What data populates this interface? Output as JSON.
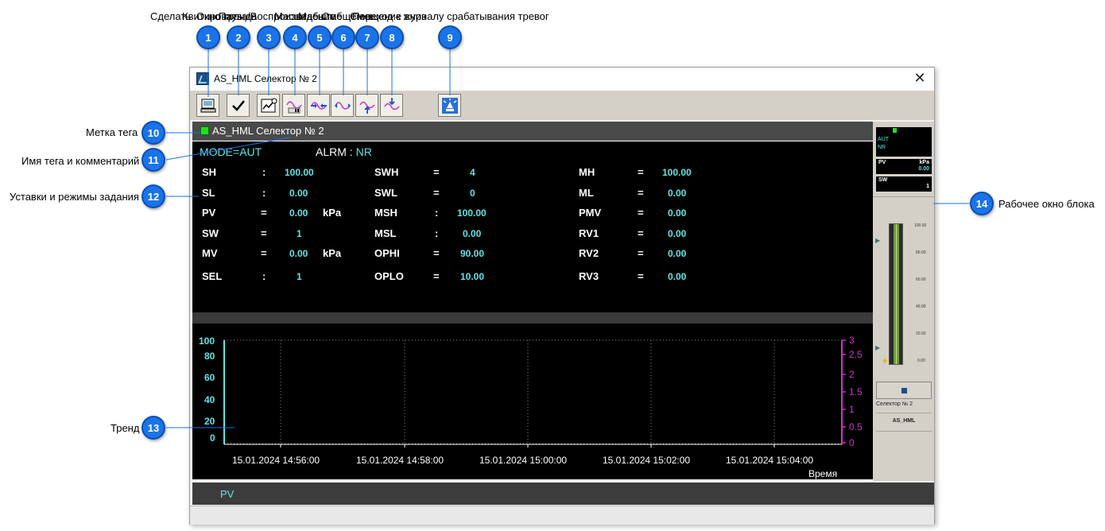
{
  "window": {
    "title": "AS_HML Селектор № 2",
    "close_glyph": "✕"
  },
  "toolbar": {
    "buttons": [
      {
        "icon": "report-icon"
      },
      {
        "icon": "checkmark-icon"
      },
      {
        "icon": "trend-window-icon"
      },
      {
        "icon": "trend-pause-icon"
      },
      {
        "icon": "scale-compress-icon"
      },
      {
        "icon": "scale-expand-icon"
      },
      {
        "icon": "scale-shift-up-icon"
      },
      {
        "icon": "scale-shift-down-icon"
      },
      {
        "icon": "alarm-light-icon"
      }
    ]
  },
  "callouts": {
    "top_label_1": "Сделать",
    "top_label_2": "Квитировать",
    "top_label_3": "Окно тренда",
    "top_label_4": "Пауза/Воспроизведение",
    "top_label_5": "Масштаб",
    "top_label_6": "Масштаб",
    "top_label_7": "Смещение",
    "top_label_8": "Смещение вниз",
    "top_label_9": "Переход к журналу срабатывания тревог",
    "n1": "1",
    "n2": "2",
    "n3": "3",
    "n4": "4",
    "n5": "5",
    "n6": "6",
    "n7": "7",
    "n8": "8",
    "n9": "9",
    "n10": "10",
    "n11": "11",
    "n12": "12",
    "n13": "13",
    "n14": "14",
    "label_10": "Метка тега",
    "label_11": "Имя тега и комментарий",
    "label_12": "Уставки и режимы задания",
    "label_13": "Тренд",
    "label_14": "Рабочее окно блока"
  },
  "tag": {
    "name": "AS_HML Селектор № 2",
    "led_color": "#22dd22"
  },
  "status": {
    "mode_label": "MODE=",
    "mode_value": "AUT",
    "alrm_label": "ALRM : ",
    "alrm_value": "NR"
  },
  "params": {
    "col1": [
      {
        "name": "SH",
        "sep": ":",
        "value": "100.00",
        "unit": ""
      },
      {
        "name": "SL",
        "sep": ":",
        "value": "0.00",
        "unit": ""
      },
      {
        "name": "PV",
        "sep": "=",
        "value": "0.00",
        "unit": "kPa"
      },
      {
        "name": "SW",
        "sep": "=",
        "value": "1",
        "unit": ""
      },
      {
        "name": "MV",
        "sep": "=",
        "value": "0.00",
        "unit": "kPa"
      },
      {
        "name": "SEL",
        "sep": ":",
        "value": "1",
        "unit": ""
      }
    ],
    "col2": [
      {
        "name": "SWH",
        "sep": "=",
        "value": "4"
      },
      {
        "name": "SWL",
        "sep": "=",
        "value": "0"
      },
      {
        "name": "MSH",
        "sep": ":",
        "value": "100.00"
      },
      {
        "name": "MSL",
        "sep": ":",
        "value": "0.00"
      },
      {
        "name": "OPHI",
        "sep": "=",
        "value": "90.00"
      },
      {
        "name": "OPLO",
        "sep": "=",
        "value": "10.00"
      }
    ],
    "col3": [
      {
        "name": "MH",
        "sep": "=",
        "value": "100.00"
      },
      {
        "name": "ML",
        "sep": "=",
        "value": "0.00"
      },
      {
        "name": "PMV",
        "sep": "=",
        "value": "0.00"
      },
      {
        "name": "RV1",
        "sep": "=",
        "value": "0.00"
      },
      {
        "name": "RV2",
        "sep": "=",
        "value": "0.00"
      },
      {
        "name": "RV3",
        "sep": "=",
        "value": "0.00"
      }
    ]
  },
  "trend": {
    "left_ticks": [
      "100",
      "80",
      "60",
      "40",
      "20",
      "0"
    ],
    "right_ticks": [
      "3",
      "2.5",
      "2",
      "1.5",
      "1",
      "0.5",
      "0"
    ],
    "time_ticks": [
      "15.01.2024 14:56:00",
      "15.01.2024 14:58:00",
      "15.01.2024 15:00:00",
      "15.01.2024 15:02:00",
      "15.01.2024 15:04:00"
    ],
    "x_axis_label": "Время",
    "left_axis_color": "#5ce6e6",
    "right_axis_color": "#cc33cc"
  },
  "side": {
    "mode": "AUT",
    "alarm": "NR",
    "pv_label": "PV",
    "pv_unit": "kPa",
    "pv_value": "0.00",
    "sw_label": "SW",
    "sw_value": "1",
    "scale": [
      "100.00",
      "80.00",
      "60.00",
      "40.00",
      "20.00",
      "0.00"
    ],
    "block_name": "Селектор № 2",
    "block_type": "AS_HML"
  },
  "pv_bar_label": "PV"
}
